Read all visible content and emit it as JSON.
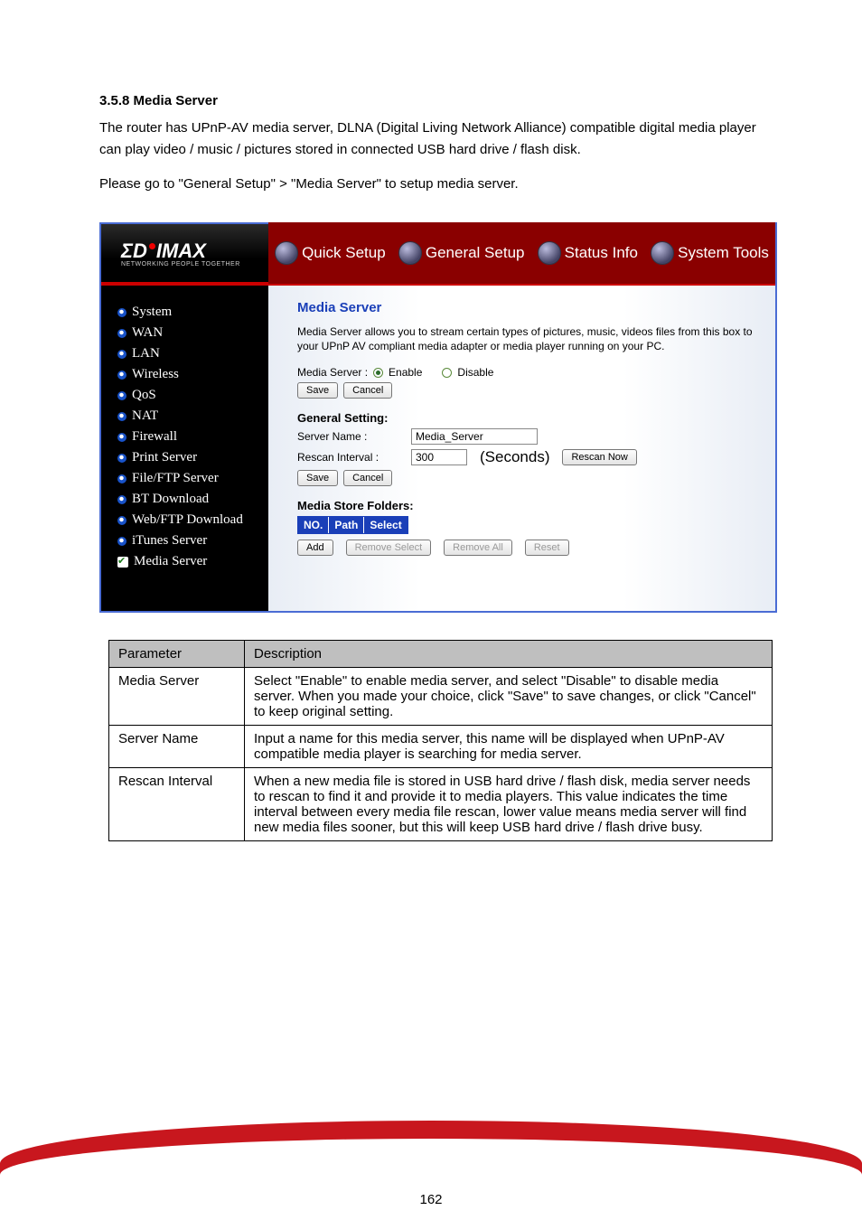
{
  "doc": {
    "heading": "3.5.8 Media Server",
    "p1": "The router has UPnP-AV media server, DLNA (Digital Living Network Alliance) compatible digital media player can play video / music / pictures stored in connected USB hard drive / flash disk.",
    "p2": "Please go to \"General Setup\" > \"Media Server\" to setup media server."
  },
  "logo": {
    "brand": "ΣDIMAX",
    "tagline": "NETWORKING PEOPLE TOGETHER"
  },
  "topnav": [
    "Quick Setup",
    "General Setup",
    "Status Info",
    "System Tools"
  ],
  "sidebar": {
    "items": [
      "System",
      "WAN",
      "LAN",
      "Wireless",
      "QoS",
      "NAT",
      "Firewall",
      "Print Server",
      "File/FTP Server",
      "BT Download",
      "Web/FTP Download",
      "iTunes Server",
      "Media Server"
    ],
    "active_index": 12
  },
  "content": {
    "title": "Media Server",
    "description": "Media Server allows you to stream certain types of pictures, music, videos files from this box to your UPnP AV compliant media adapter or media player running on your PC.",
    "media_label": "Media Server :",
    "enable": "Enable",
    "disable": "Disable",
    "save": "Save",
    "cancel": "Cancel",
    "general_setting": "General Setting:",
    "server_name_label": "Server Name :",
    "server_name_value": "Media_Server",
    "rescan_label": "Rescan Interval :",
    "rescan_value": "300",
    "seconds": "(Seconds)",
    "rescan_now": "Rescan Now",
    "folders_title": "Media Store Folders:",
    "col_no": "NO.",
    "col_path": "Path",
    "col_select": "Select",
    "add": "Add",
    "remove_select": "Remove Select",
    "remove_all": "Remove All",
    "reset": "Reset"
  },
  "table": {
    "h1": "Parameter",
    "h2": "Description",
    "rows": [
      {
        "p": "Media Server",
        "d": "Select \"Enable\" to enable media server, and select \"Disable\" to disable media server. When you made your choice, click \"Save\" to save changes, or click \"Cancel\" to keep original setting."
      },
      {
        "p": "Server Name",
        "d": "Input a name for this media server, this name will be displayed when UPnP-AV compatible media player is searching for media server."
      },
      {
        "p": "Rescan Interval",
        "d": "When a new media file is stored in USB hard drive / flash disk, media server needs to rescan to find it and provide it to media players. This value indicates the time interval between every media file rescan, lower value means media server will find new media files sooner, but this will keep USB hard drive / flash drive busy."
      }
    ]
  },
  "page_number": "162"
}
